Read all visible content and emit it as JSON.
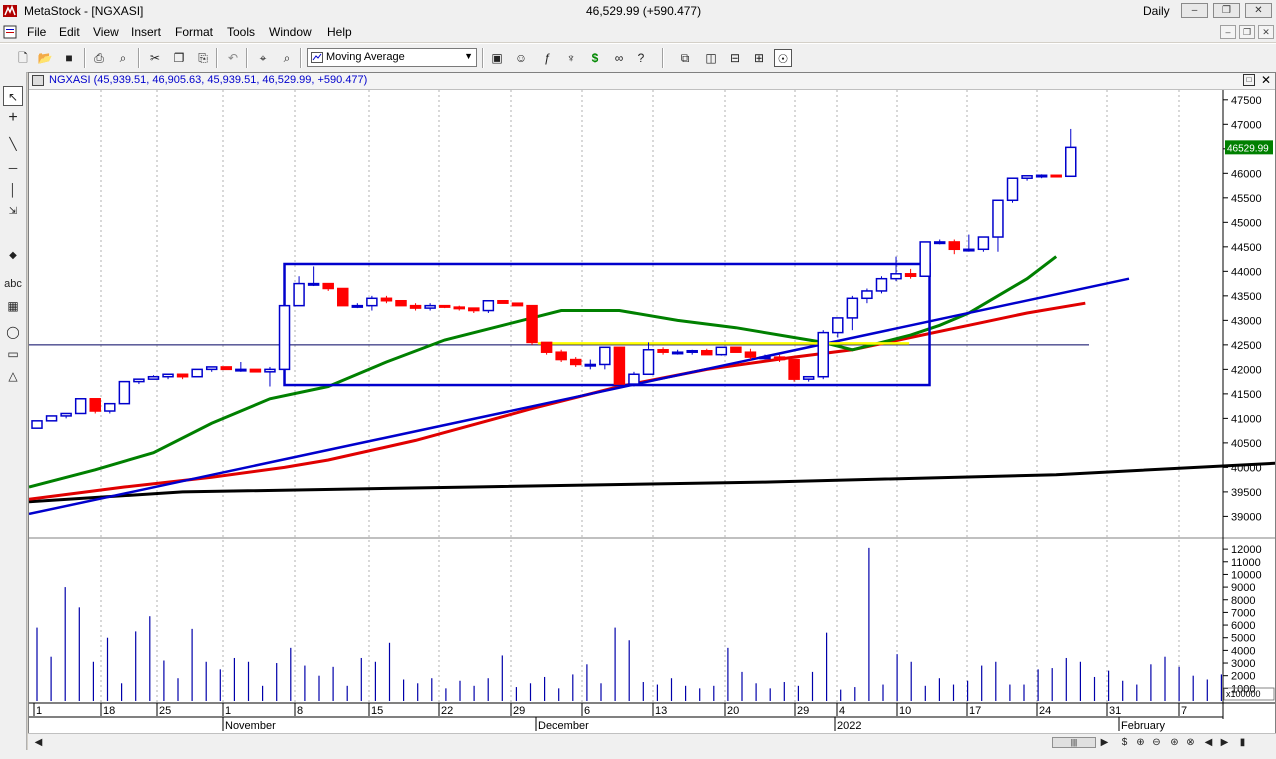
{
  "window": {
    "app_title": "MetaStock - [NGXASI]",
    "quote": "46,529.99 (+590.477)",
    "period": "Daily"
  },
  "menu": [
    "File",
    "Edit",
    "View",
    "Insert",
    "Format",
    "Tools",
    "Window",
    "Help"
  ],
  "toolbar": {
    "indicator_selected": "Moving Average",
    "icons": [
      "new-icon",
      "open-icon",
      "save-icon",
      "print-icon",
      "print-preview-icon",
      "cut-icon",
      "copy-icon",
      "paste-icon",
      "undo-icon",
      "zoom-icon",
      "zoom-out-icon",
      "indicator-builder-icon",
      "explorer-icon",
      "formula-icon",
      "expert-advisor-icon",
      "system-tester-icon",
      "binoculars-icon",
      "help-icon",
      "cascade-icon",
      "tile-vertical-icon",
      "tile-horizontal-icon",
      "tile-icon",
      "snapshot-icon"
    ]
  },
  "left_tools": [
    "pointer-icon",
    "crosshair-icon",
    "trendline-icon",
    "horizontal-line-icon",
    "vertical-line-icon",
    "fibonacci-icon",
    "text-icon",
    "grid-icon",
    "ellipse-icon",
    "rectangle-icon",
    "triangle-icon"
  ],
  "left_tools_text": {
    "text_tool": "abc"
  },
  "chart_header": "NGXASI (45,939.51, 46,905.63, 45,939.51, 46,529.99, +590.477)",
  "chart_data": {
    "type": "candlestick",
    "symbol": "NGXASI",
    "last_value_label": "46529.99",
    "price_axis": {
      "ylim": [
        38600,
        47700
      ],
      "ticks": [
        47500,
        47000,
        46500,
        46000,
        45500,
        45000,
        44500,
        44000,
        43500,
        43000,
        42500,
        42000,
        41500,
        41000,
        40500,
        40000,
        39500,
        39000
      ]
    },
    "volume_axis": {
      "ylim": [
        0,
        12800
      ],
      "ticks": [
        12000,
        11000,
        10000,
        9000,
        8000,
        7000,
        6000,
        5000,
        4000,
        3000,
        2000,
        1000
      ],
      "multiplier_label": "x100000"
    },
    "x_axis": {
      "day_labels": [
        "1",
        "18",
        "25",
        "1",
        "8",
        "15",
        "22",
        "29",
        "6",
        "13",
        "20",
        "29",
        "4",
        "10",
        "17",
        "24",
        "31",
        "7"
      ],
      "month_labels": [
        "November",
        "December",
        "2022",
        "February"
      ]
    },
    "candles": [
      {
        "o": 40800,
        "h": 40950,
        "l": 40800,
        "c": 40950
      },
      {
        "o": 40950,
        "h": 41050,
        "l": 40950,
        "c": 41050
      },
      {
        "o": 41050,
        "h": 41100,
        "l": 41000,
        "c": 41100
      },
      {
        "o": 41100,
        "h": 41400,
        "l": 41100,
        "c": 41400
      },
      {
        "o": 41400,
        "h": 41400,
        "l": 41100,
        "c": 41150
      },
      {
        "o": 41150,
        "h": 41300,
        "l": 41100,
        "c": 41300
      },
      {
        "o": 41300,
        "h": 41750,
        "l": 41300,
        "c": 41750
      },
      {
        "o": 41750,
        "h": 41800,
        "l": 41700,
        "c": 41800
      },
      {
        "o": 41800,
        "h": 41880,
        "l": 41800,
        "c": 41850
      },
      {
        "o": 41850,
        "h": 41900,
        "l": 41800,
        "c": 41900
      },
      {
        "o": 41900,
        "h": 41900,
        "l": 41800,
        "c": 41850
      },
      {
        "o": 41850,
        "h": 42000,
        "l": 41850,
        "c": 42000
      },
      {
        "o": 42000,
        "h": 42050,
        "l": 41950,
        "c": 42050
      },
      {
        "o": 42050,
        "h": 42050,
        "l": 42000,
        "c": 42000
      },
      {
        "o": 42000,
        "h": 42150,
        "l": 41950,
        "c": 42000
      },
      {
        "o": 42000,
        "h": 42000,
        "l": 41950,
        "c": 41950
      },
      {
        "o": 41950,
        "h": 42050,
        "l": 41650,
        "c": 42000
      },
      {
        "o": 42000,
        "h": 43300,
        "l": 42000,
        "c": 43300
      },
      {
        "o": 43300,
        "h": 43900,
        "l": 43300,
        "c": 43750
      },
      {
        "o": 43750,
        "h": 44100,
        "l": 43700,
        "c": 43750
      },
      {
        "o": 43750,
        "h": 43750,
        "l": 43600,
        "c": 43650
      },
      {
        "o": 43650,
        "h": 43650,
        "l": 43300,
        "c": 43300
      },
      {
        "o": 43300,
        "h": 43350,
        "l": 43250,
        "c": 43300
      },
      {
        "o": 43300,
        "h": 43500,
        "l": 43200,
        "c": 43450
      },
      {
        "o": 43450,
        "h": 43500,
        "l": 43350,
        "c": 43400
      },
      {
        "o": 43400,
        "h": 43400,
        "l": 43300,
        "c": 43300
      },
      {
        "o": 43300,
        "h": 43350,
        "l": 43200,
        "c": 43250
      },
      {
        "o": 43250,
        "h": 43350,
        "l": 43200,
        "c": 43300
      },
      {
        "o": 43300,
        "h": 43300,
        "l": 43250,
        "c": 43270
      },
      {
        "o": 43270,
        "h": 43300,
        "l": 43200,
        "c": 43250
      },
      {
        "o": 43250,
        "h": 43250,
        "l": 43150,
        "c": 43200
      },
      {
        "o": 43200,
        "h": 43400,
        "l": 43150,
        "c": 43400
      },
      {
        "o": 43400,
        "h": 43400,
        "l": 43350,
        "c": 43350
      },
      {
        "o": 43350,
        "h": 43350,
        "l": 43300,
        "c": 43300
      },
      {
        "o": 43300,
        "h": 43300,
        "l": 42500,
        "c": 42550
      },
      {
        "o": 42550,
        "h": 42550,
        "l": 42300,
        "c": 42350
      },
      {
        "o": 42350,
        "h": 42400,
        "l": 42150,
        "c": 42200
      },
      {
        "o": 42200,
        "h": 42250,
        "l": 42050,
        "c": 42100
      },
      {
        "o": 42100,
        "h": 42200,
        "l": 42000,
        "c": 42100
      },
      {
        "o": 42100,
        "h": 42450,
        "l": 42000,
        "c": 42450
      },
      {
        "o": 42450,
        "h": 42450,
        "l": 41700,
        "c": 41700
      },
      {
        "o": 41700,
        "h": 41950,
        "l": 41650,
        "c": 41900
      },
      {
        "o": 41900,
        "h": 42550,
        "l": 41900,
        "c": 42400
      },
      {
        "o": 42400,
        "h": 42450,
        "l": 42300,
        "c": 42350
      },
      {
        "o": 42350,
        "h": 42400,
        "l": 42300,
        "c": 42350
      },
      {
        "o": 42350,
        "h": 42400,
        "l": 42300,
        "c": 42380
      },
      {
        "o": 42380,
        "h": 42420,
        "l": 42300,
        "c": 42300
      },
      {
        "o": 42300,
        "h": 42450,
        "l": 42280,
        "c": 42450
      },
      {
        "o": 42450,
        "h": 42450,
        "l": 42350,
        "c": 42350
      },
      {
        "o": 42350,
        "h": 42420,
        "l": 42200,
        "c": 42250
      },
      {
        "o": 42250,
        "h": 42300,
        "l": 42200,
        "c": 42250
      },
      {
        "o": 42250,
        "h": 42300,
        "l": 42150,
        "c": 42200
      },
      {
        "o": 42200,
        "h": 42200,
        "l": 41750,
        "c": 41800
      },
      {
        "o": 41800,
        "h": 41850,
        "l": 41750,
        "c": 41850
      },
      {
        "o": 41850,
        "h": 42800,
        "l": 41800,
        "c": 42750
      },
      {
        "o": 42750,
        "h": 43050,
        "l": 42650,
        "c": 43050
      },
      {
        "o": 43050,
        "h": 43500,
        "l": 42800,
        "c": 43450
      },
      {
        "o": 43450,
        "h": 43650,
        "l": 43350,
        "c": 43600
      },
      {
        "o": 43600,
        "h": 43900,
        "l": 43550,
        "c": 43850
      },
      {
        "o": 43850,
        "h": 44300,
        "l": 43800,
        "c": 43950
      },
      {
        "o": 43950,
        "h": 44050,
        "l": 43850,
        "c": 43900
      },
      {
        "o": 43900,
        "h": 44600,
        "l": 43900,
        "c": 44600
      },
      {
        "o": 44600,
        "h": 44650,
        "l": 44550,
        "c": 44600
      },
      {
        "o": 44600,
        "h": 44650,
        "l": 44350,
        "c": 44450
      },
      {
        "o": 44450,
        "h": 44750,
        "l": 44400,
        "c": 44450
      },
      {
        "o": 44450,
        "h": 44700,
        "l": 44400,
        "c": 44700
      },
      {
        "o": 44700,
        "h": 45450,
        "l": 44400,
        "c": 45450
      },
      {
        "o": 45450,
        "h": 45900,
        "l": 45400,
        "c": 45900
      },
      {
        "o": 45900,
        "h": 45950,
        "l": 45850,
        "c": 45950
      },
      {
        "o": 45950,
        "h": 45980,
        "l": 45900,
        "c": 45960
      },
      {
        "o": 45960,
        "h": 45960,
        "l": 45920,
        "c": 45939.51
      },
      {
        "o": 45939.51,
        "h": 46905.63,
        "l": 45939.51,
        "c": 46529.99
      }
    ],
    "volume": [
      5800,
      3500,
      9000,
      7400,
      3100,
      5000,
      1400,
      5500,
      6700,
      3200,
      1800,
      5700,
      3100,
      2500,
      3400,
      3100,
      1200,
      3000,
      4200,
      2800,
      2000,
      2700,
      1200,
      3400,
      3100,
      4600,
      1700,
      1400,
      1800,
      1000,
      1600,
      1200,
      1800,
      3600,
      1100,
      1400,
      1900,
      1000,
      2100,
      2900,
      1400,
      5800,
      4800,
      1500,
      1300,
      1800,
      1200,
      1000,
      1200,
      4200,
      2300,
      1400,
      1000,
      1500,
      1200,
      2300,
      5400,
      900,
      1100,
      12100,
      1300,
      3700,
      3100,
      1200,
      1800,
      1300,
      1600,
      2800,
      3100,
      1300,
      1300,
      2500,
      2600,
      3400,
      3100,
      1900,
      2400,
      1600,
      1300,
      2900,
      3500,
      2700,
      2000,
      1700,
      2100
    ]
  },
  "colors": {
    "up_candle": "#0000cc",
    "down_candle": "#ff0000",
    "ma_green": "#008000",
    "ma_red": "#e00000",
    "ma_black": "#000000",
    "trendline_blue": "#0000cc",
    "rectangle_blue": "#0000cc",
    "yellow_line": "#ffff00"
  }
}
